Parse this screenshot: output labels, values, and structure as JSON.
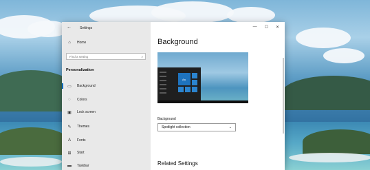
{
  "window": {
    "title": "Settings",
    "controls": {
      "minimize": "—",
      "maximize": "☐",
      "close": "✕"
    }
  },
  "sidebar": {
    "home": {
      "label": "Home",
      "icon": "home-icon"
    },
    "search": {
      "placeholder": "Find a setting",
      "icon": "search-icon"
    },
    "section_title": "Personalization",
    "items": [
      {
        "label": "Background",
        "icon": "picture-icon",
        "active": true
      },
      {
        "label": "Colors",
        "icon": "palette-icon",
        "active": false
      },
      {
        "label": "Lock screen",
        "icon": "monitor-lock-icon",
        "active": false
      },
      {
        "label": "Themes",
        "icon": "brush-icon",
        "active": false
      },
      {
        "label": "Fonts",
        "icon": "font-icon",
        "active": false
      },
      {
        "label": "Start",
        "icon": "start-icon",
        "active": false
      },
      {
        "label": "Taskbar",
        "icon": "taskbar-icon",
        "active": false
      }
    ]
  },
  "main": {
    "page_title": "Background",
    "preview": {
      "tile_label": "Aa"
    },
    "background_field": {
      "label": "Background",
      "value": "Spotlight collection"
    },
    "related_heading": "Related Settings"
  },
  "colors": {
    "accent": "#0067b8",
    "sidebar_bg": "#e9e9e9",
    "window_bg": "#ffffff"
  }
}
